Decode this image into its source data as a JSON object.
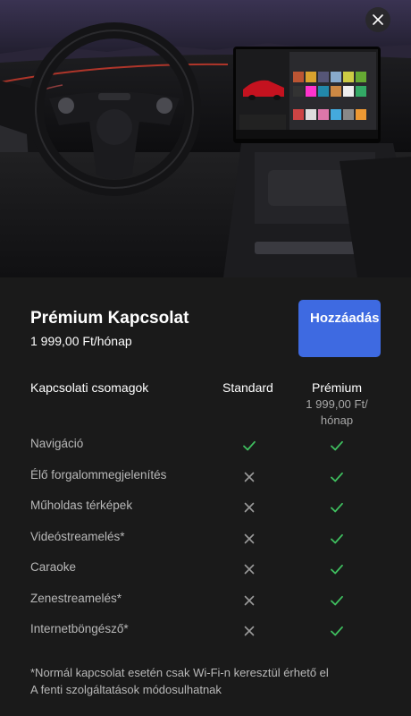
{
  "hero": {
    "image": "car-interior-photo",
    "close_icon": "close-icon"
  },
  "package": {
    "title": "Prémium Kapcsolat",
    "price": "1 999,00 Ft/hónap",
    "add_button": "Hozzáadás"
  },
  "table": {
    "header_features": "Kapcsolati csomagok",
    "header_standard": "Standard",
    "header_premium": "Prémium",
    "header_premium_price": "1 999,00 Ft/ hónap",
    "rows": [
      {
        "label": "Navigáció",
        "standard": "check",
        "premium": "check"
      },
      {
        "label": "Élő forgalommegjelenítés",
        "standard": "cross",
        "premium": "check"
      },
      {
        "label": "Műholdas térképek",
        "standard": "cross",
        "premium": "check"
      },
      {
        "label": "Videóstreamelés*",
        "standard": "cross",
        "premium": "check"
      },
      {
        "label": "Caraoke",
        "standard": "cross",
        "premium": "check"
      },
      {
        "label": "Zenestreamelés*",
        "standard": "cross",
        "premium": "check"
      },
      {
        "label": "Internetböngésző*",
        "standard": "cross",
        "premium": "check"
      }
    ]
  },
  "footnote": {
    "line1": "*Normál kapcsolat esetén csak Wi-Fi-n keresztül érhető el",
    "line2": "A fenti szolgáltatások módosulhatnak"
  },
  "colors": {
    "accent": "#3e6ae1",
    "check": "#3fbf5f",
    "cross": "#9a9a9a"
  }
}
